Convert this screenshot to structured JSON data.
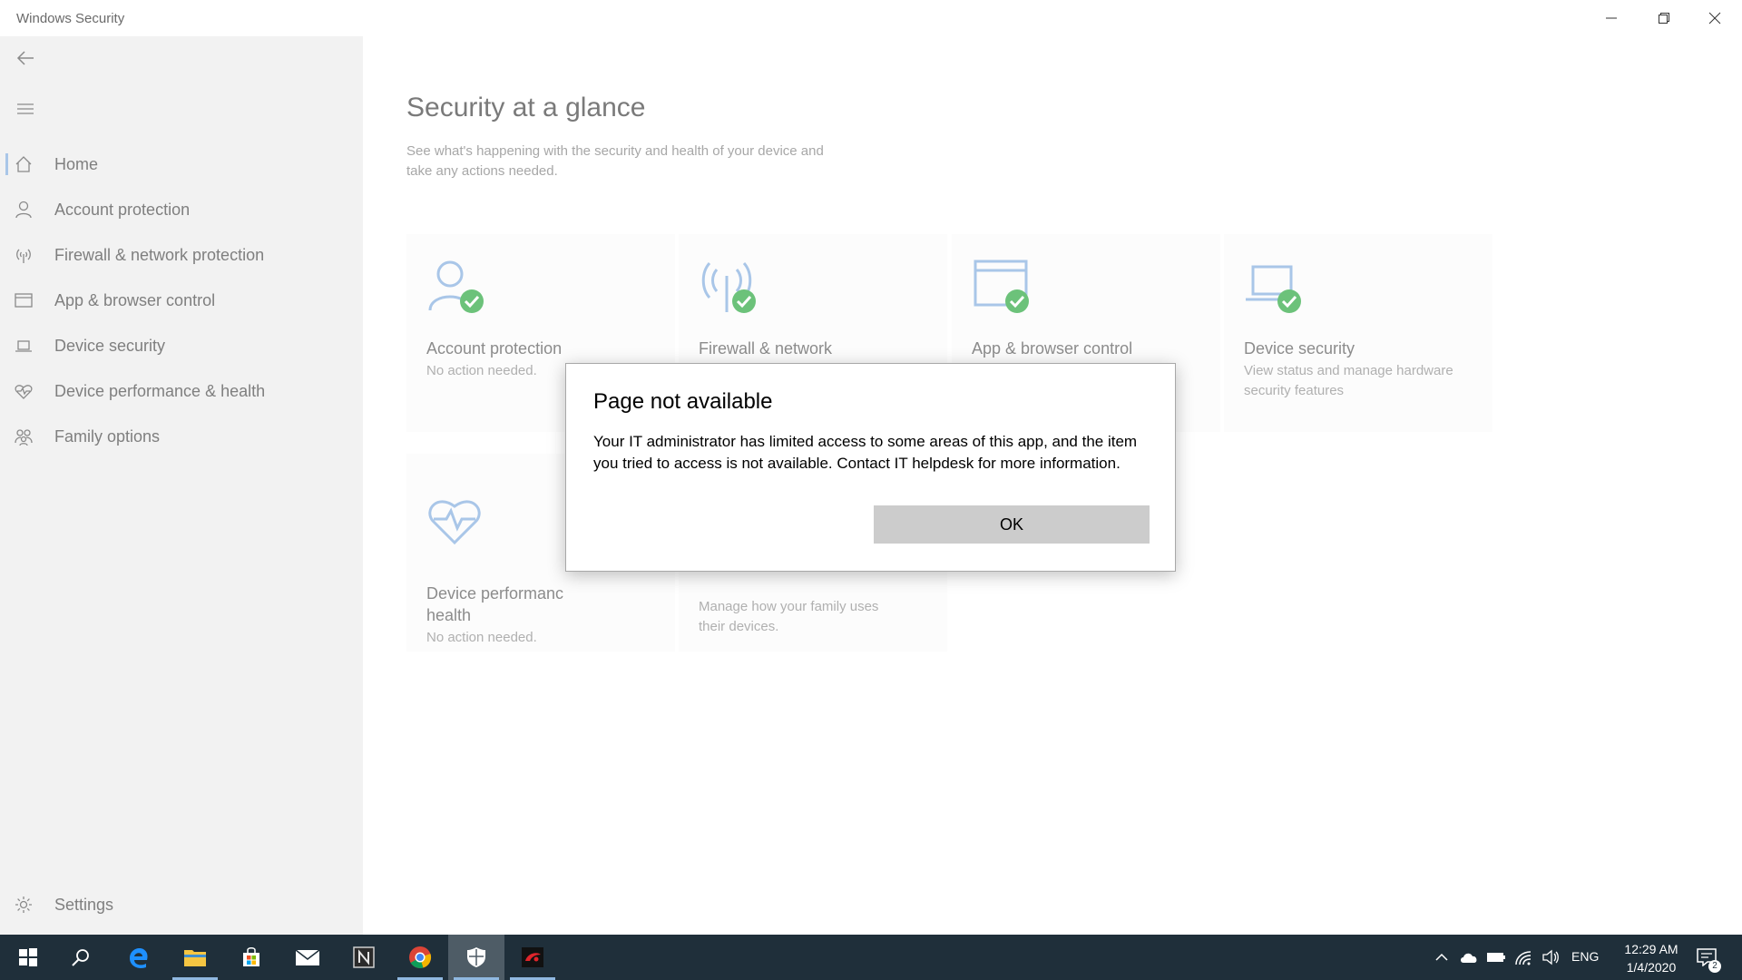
{
  "window": {
    "title": "Windows Security"
  },
  "sidebar": {
    "items": [
      {
        "label": "Home",
        "icon": "home-icon",
        "active": true
      },
      {
        "label": "Account protection",
        "icon": "person-icon"
      },
      {
        "label": "Firewall & network protection",
        "icon": "antenna-icon"
      },
      {
        "label": "App & browser control",
        "icon": "browser-window-icon"
      },
      {
        "label": "Device security",
        "icon": "laptop-icon"
      },
      {
        "label": "Device performance & health",
        "icon": "heart-icon"
      },
      {
        "label": "Family options",
        "icon": "family-icon"
      }
    ],
    "settings_label": "Settings"
  },
  "main": {
    "title": "Security at a glance",
    "subtitle": "See what's happening with the security and health of your device and take any actions needed.",
    "tiles": [
      {
        "name": "Account protection",
        "desc": "No action needed."
      },
      {
        "name": "Firewall & network",
        "desc": ""
      },
      {
        "name": "App & browser control",
        "desc": ""
      },
      {
        "name": "Device security",
        "desc": "View status and manage hardware security features"
      },
      {
        "name": "Device performanc health",
        "name_line1": "Device performanc",
        "name_line2": "health",
        "desc": "No action needed."
      },
      {
        "name": "",
        "desc": "Manage how your family uses their devices."
      }
    ]
  },
  "dialog": {
    "title": "Page not available",
    "message": "Your IT administrator has limited access to some areas of this app, and the item you tried to access is not available. Contact IT helpdesk for more information.",
    "ok_label": "OK"
  },
  "taskbar": {
    "apps": [
      "windows-start-icon",
      "search-icon",
      "edge-icon",
      "file-explorer-icon",
      "store-icon",
      "mail-icon",
      "notion-icon",
      "chrome-icon",
      "windows-security-icon",
      "game-app-icon"
    ],
    "tray": {
      "language": "ENG",
      "time": "12:29 AM",
      "date": "1/4/2020",
      "notification_count": "2"
    }
  },
  "colors": {
    "accent_icon": "#a9c6e8",
    "check_green": "#6cc27a",
    "taskbar_bg": "#1f2f3a"
  }
}
